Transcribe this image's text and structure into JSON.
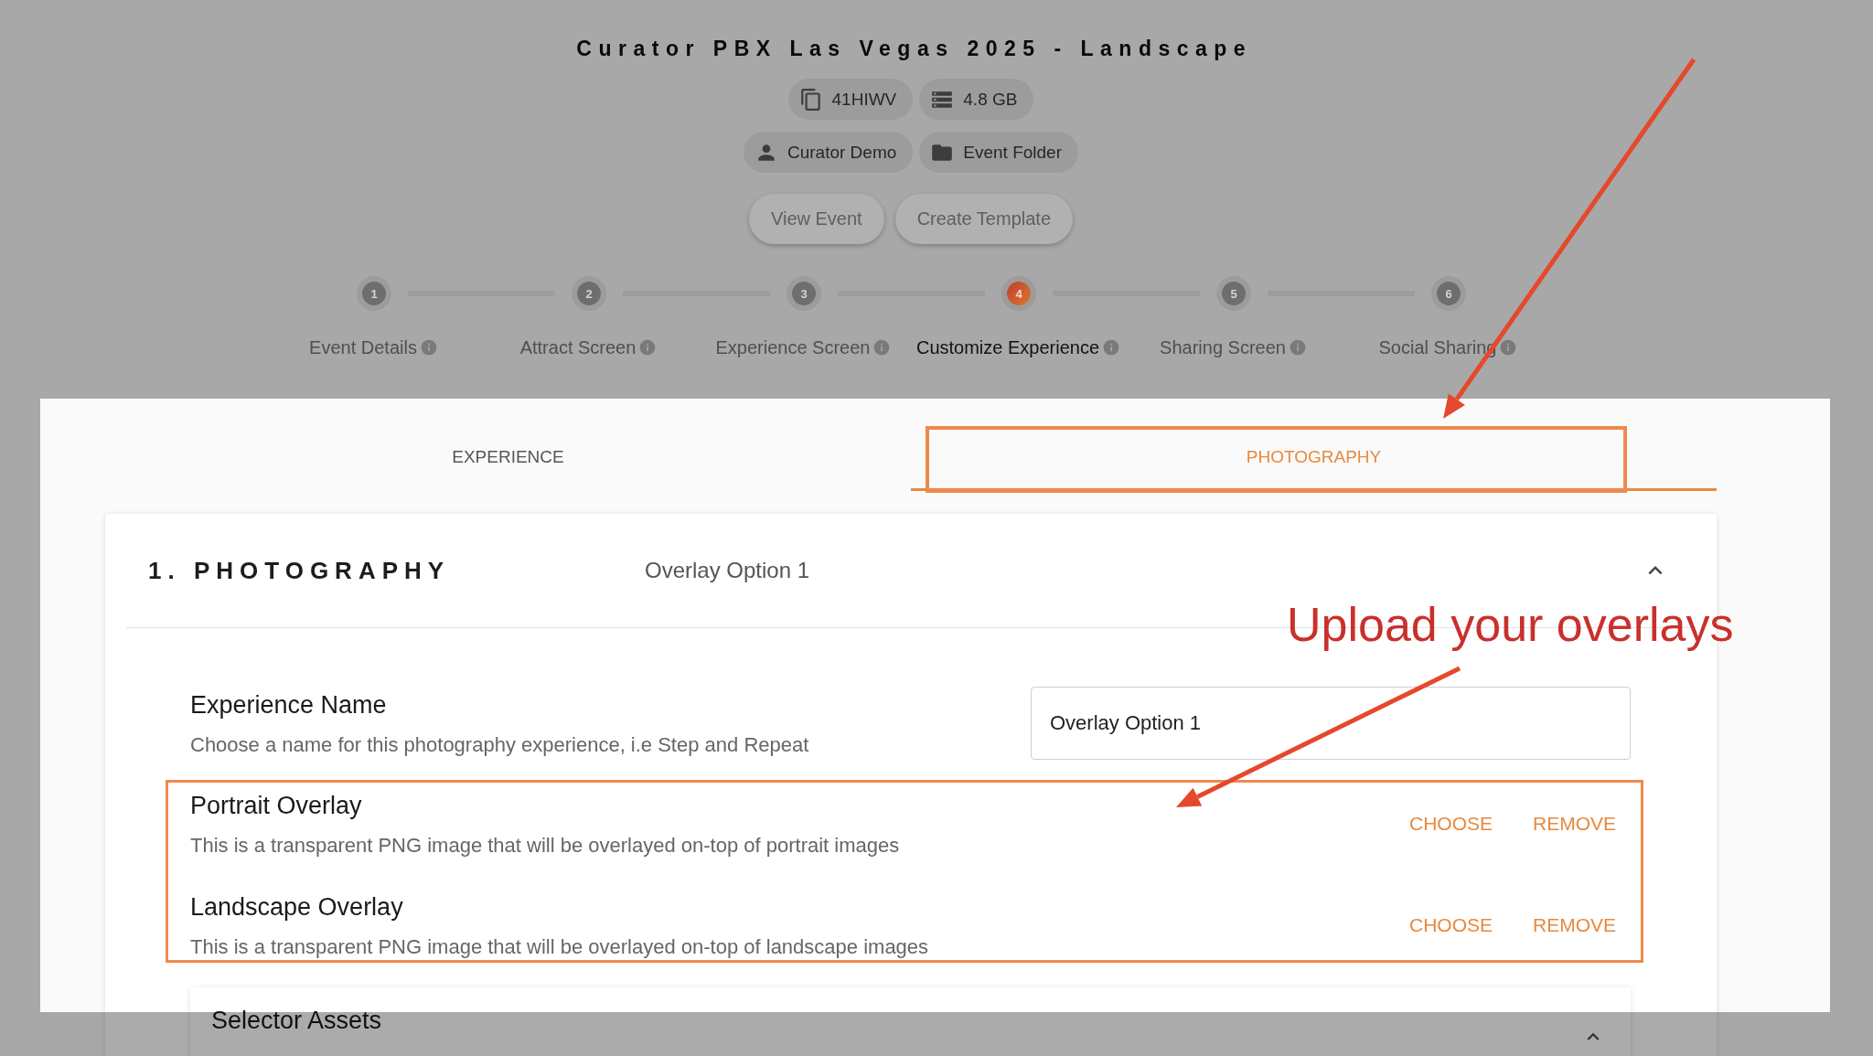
{
  "header": {
    "title": "Curator PBX Las Vegas 2025 - Landscape",
    "chip_rows": [
      [
        {
          "kind": "copy",
          "label": "41HIWV"
        },
        {
          "kind": "storage",
          "label": "4.8 GB"
        }
      ],
      [
        {
          "kind": "user",
          "label": "Curator Demo"
        },
        {
          "kind": "folder",
          "label": "Event Folder"
        }
      ]
    ],
    "buttons": [
      "View Event",
      "Create Template"
    ]
  },
  "stepper": {
    "steps": [
      {
        "number": "1",
        "label": "Event Details",
        "selected": false
      },
      {
        "number": "2",
        "label": "Attract Screen",
        "selected": false
      },
      {
        "number": "3",
        "label": "Experience Screen",
        "selected": false
      },
      {
        "number": "4",
        "label": "Customize Experience",
        "selected": true
      },
      {
        "number": "5",
        "label": "Sharing Screen",
        "selected": false
      },
      {
        "number": "6",
        "label": "Social Sharing",
        "selected": false
      }
    ]
  },
  "tabs": [
    {
      "label": "EXPERIENCE",
      "selected": false
    },
    {
      "label": "PHOTOGRAPHY",
      "selected": true
    }
  ],
  "section": {
    "title": "1. PHOTOGRAPHY",
    "summary": "Overlay Option 1",
    "expanded": true,
    "fields": [
      {
        "kind": "text",
        "label": "Experience Name",
        "description": "Choose a name for this photography experience, i.e Step and Repeat",
        "value": "Overlay Option 1"
      },
      {
        "kind": "upload",
        "label": "Portrait Overlay",
        "description": "This is a transparent PNG image that will be overlayed on-top of portrait images",
        "actions": [
          "CHOOSE",
          "REMOVE"
        ]
      },
      {
        "kind": "upload",
        "label": "Landscape Overlay",
        "description": "This is a transparent PNG image that will be overlayed on-top of landscape images",
        "actions": [
          "CHOOSE",
          "REMOVE"
        ]
      }
    ],
    "subsections": [
      {
        "title": "Selector Assets",
        "expanded": true
      }
    ]
  },
  "annotation": {
    "text": "Upload your overlays"
  }
}
